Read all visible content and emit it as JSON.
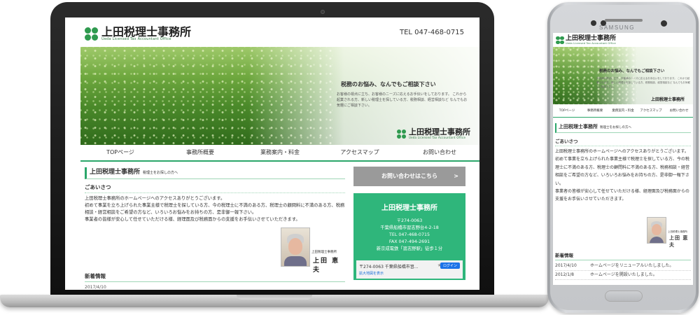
{
  "brand": {
    "name": "上田税理士事務所",
    "sub": "Ueda Licensed Tax Accountant Office",
    "tel": "TEL 047-468-0715",
    "accent": "#2aa66a"
  },
  "hero": {
    "title": "税務のお悩み、なんでもご相談下さい",
    "body": "お客様の視点に立ち、お客様のニーズに応えるお手伝いをしております。 これから起業される方、新しい税理士を探している方、税務相談、経営相談など なんでもお気軽にご相談下さい。"
  },
  "nav": [
    "TOPページ",
    "事務所概要",
    "業務案内・料金",
    "アクセスマップ",
    "お問い合わせ"
  ],
  "section": {
    "title": "上田税理士事務所",
    "subtitle": "税理士をお探しの方へ",
    "greeting_heading": "ごあいさつ",
    "paragraphs": [
      "上田税理士事務所のホームページへのアクセスありがとうございます。",
      "初めて事業を立ち上げられた事業主様で税理士を探している方、今の税理士に不満のある方、税理士の顧問料に不満のある方、税務相談・経営相談をご希望の方など、いろいろお悩みをお持ちの方、是非御一報下さい。",
      "事業者の皆様が安心して任せていただける様、経理面及び税務面からの支援をお手伝いさせていただきます。"
    ],
    "signature_role": "上田税理士事務所",
    "signature_name": "上田 恵夫"
  },
  "news": {
    "heading": "新着情報",
    "items": [
      {
        "date": "2017/4/10",
        "text": "ホームページをリニューアルいたしました。"
      },
      {
        "date": "2012/1/8",
        "text": "ホームページを開設いたしました。"
      }
    ]
  },
  "sidebar": {
    "contact_button": "お問い合わせはこちら",
    "contact_arrow": ">",
    "office_name": "上田税理士事務所",
    "office_lines": [
      "〒274-0063",
      "千葉県船橋市習志野台4-2-18",
      "TEL 047-468-0715",
      "FAX 047-494-2691",
      "新京成電鉄「習志野駅」徒歩１分"
    ],
    "map_address": "〒274-0063 千葉県船橋市習...",
    "map_link": "拡大地図を表示",
    "map_login": "ログイン",
    "map_star": "★"
  },
  "phone": {
    "brand_text": "SAMSUNG",
    "hero_logo": "上田税理士事務所",
    "text_lines": [
      "上田税理士事務所のホームページへのアクセスありがとうございます。",
      "初めて事業を立ち上げられた事業主様で税理士を探している方、今の税理士に不満のある方、税理士の顧問料に不満のある方、税務相談・経営相談をご希望の方など、いろいろお悩みをお持ちの方、是非御一報下さい。",
      "事業者の皆様が安心して任せていただける様、経理面及び税務面からの支援をお手伝いさせていただきます。"
    ]
  }
}
